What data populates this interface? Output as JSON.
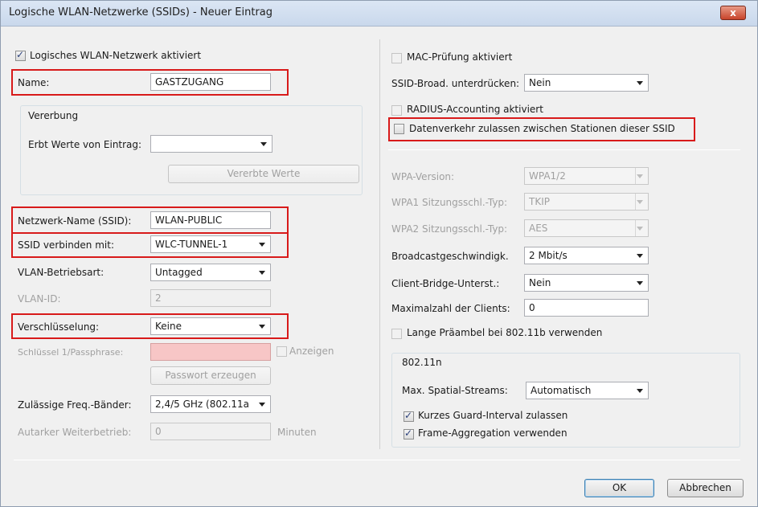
{
  "window": {
    "title": "Logische WLAN-Netzwerke (SSIDs) - Neuer Eintrag",
    "close_label": "x"
  },
  "left": {
    "wlan_active_label": "Logisches WLAN-Netzwerk aktiviert",
    "name_label": "Name:",
    "name_value": "GASTZUGANG",
    "inherit_group_label": "Vererbung",
    "inherit_from_label": "Erbt Werte von Eintrag:",
    "inherit_from_value": "",
    "inherited_values_button": "Vererbte Werte",
    "ssid_label": "Netzwerk-Name (SSID):",
    "ssid_value": "WLAN-PUBLIC",
    "ssid_connect_label": "SSID verbinden mit:",
    "ssid_connect_value": "WLC-TUNNEL-1",
    "vlan_mode_label": "VLAN-Betriebsart:",
    "vlan_mode_value": "Untagged",
    "vlan_id_label": "VLAN-ID:",
    "vlan_id_value": "2",
    "encryption_label": "Verschlüsselung:",
    "encryption_value": "Keine",
    "key_label": "Schlüssel 1/Passphrase:",
    "key_value": "",
    "show_label": "Anzeigen",
    "generate_password_button": "Passwort erzeugen",
    "freq_bands_label": "Zulässige Freq.-Bänder:",
    "freq_bands_value": "2,4/5 GHz (802.11a",
    "autarkic_label": "Autarker Weiterbetrieb:",
    "autarkic_value": "0",
    "minutes_label": "Minuten"
  },
  "right": {
    "mac_check_label": "MAC-Prüfung aktiviert",
    "ssid_broadcast_label": "SSID-Broad. unterdrücken:",
    "ssid_broadcast_value": "Nein",
    "radius_accounting_label": "RADIUS-Accounting aktiviert",
    "allow_traffic_label": "Datenverkehr zulassen zwischen Stationen dieser SSID",
    "wpa_version_label": "WPA-Version:",
    "wpa_version_value": "WPA1/2",
    "wpa1_key_type_label": "WPA1 Sitzungsschl.-Typ:",
    "wpa1_key_type_value": "TKIP",
    "wpa2_key_type_label": "WPA2 Sitzungsschl.-Typ:",
    "wpa2_key_type_value": "AES",
    "broadcast_speed_label": "Broadcastgeschwindigk.",
    "broadcast_speed_value": "2 Mbit/s",
    "client_bridge_label": "Client-Bridge-Unterst.:",
    "client_bridge_value": "Nein",
    "max_clients_label": "Maximalzahl der Clients:",
    "max_clients_value": "0",
    "long_preamble_label": "Lange Präambel bei 802.11b verwenden",
    "n_group_label": "802.11n",
    "spatial_streams_label": "Max. Spatial-Streams:",
    "spatial_streams_value": "Automatisch",
    "short_guard_label": "Kurzes Guard-Interval zulassen",
    "frame_aggregation_label": "Frame-Aggregation verwenden"
  },
  "buttons": {
    "ok": "OK",
    "cancel": "Abbrechen"
  },
  "colors": {
    "highlight": "#d81a1a",
    "disabled_text": "#a0a0a0",
    "pink_field": "#f7c6c6"
  }
}
